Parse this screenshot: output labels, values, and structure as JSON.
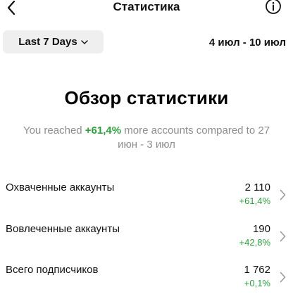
{
  "header": {
    "title": "Статистика",
    "back_icon": "chevron-left-icon",
    "info_icon": "info-icon"
  },
  "filter": {
    "period_label": "Last 7 Days",
    "period_icon": "chevron-down-icon",
    "date_range": "4 июл - 10 июл"
  },
  "overview": {
    "title": "Обзор статистики",
    "subtitle_prefix": "You reached ",
    "subtitle_highlight": "+61,4%",
    "subtitle_suffix": " more accounts compared to 27 июн - 3 июл"
  },
  "metrics": [
    {
      "label": "Охваченные аккаунты",
      "value": "2 110",
      "change": "+61,4%"
    },
    {
      "label": "Вовлеченные аккаунты",
      "value": "190",
      "change": "+42,8%"
    },
    {
      "label": "Всего подписчиков",
      "value": "1 762",
      "change": "+0,1%"
    }
  ],
  "colors": {
    "positive": "#2e9e3e",
    "muted": "#8e8e8e",
    "chip_bg": "#efefef"
  }
}
